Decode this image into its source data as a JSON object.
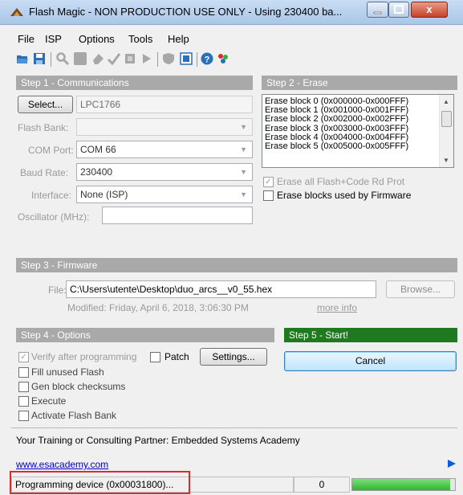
{
  "window": {
    "title": "Flash Magic - NON PRODUCTION USE ONLY - Using 230400 ba...",
    "close_glyph": "x"
  },
  "menu": [
    "File",
    "ISP",
    "Options",
    "Tools",
    "Help"
  ],
  "toolbar": {
    "icons": [
      "open-icon",
      "save-icon",
      "search-icon",
      "blank-check-icon",
      "erase-icon",
      "verify-icon",
      "read-icon",
      "go-icon",
      "security-icon",
      "terminal-icon",
      "help-icon",
      "people-icon"
    ]
  },
  "step1": {
    "header": "Step 1 - Communications",
    "select_label": "Select...",
    "device": "LPC1766",
    "flash_bank_label": "Flash Bank:",
    "flash_bank_value": "",
    "com_port_label": "COM Port:",
    "com_port_value": "COM 66",
    "baud_label": "Baud Rate:",
    "baud_value": "230400",
    "interface_label": "Interface:",
    "interface_value": "None (ISP)",
    "osc_label": "Oscillator (MHz):",
    "osc_value": ""
  },
  "step2": {
    "header": "Step 2 - Erase",
    "blocks": [
      "Erase block 0 (0x000000-0x000FFF)",
      "Erase block 1 (0x001000-0x001FFF)",
      "Erase block 2 (0x002000-0x002FFF)",
      "Erase block 3 (0x003000-0x003FFF)",
      "Erase block 4 (0x004000-0x004FFF)",
      "Erase block 5 (0x005000-0x005FFF)"
    ],
    "erase_all_label": "Erase all Flash+Code Rd Prot",
    "erase_used_label": "Erase blocks used by Firmware"
  },
  "step3": {
    "header": "Step 3 - Firmware",
    "file_label": "File:",
    "file_value": "C:\\Users\\utente\\Desktop\\duo_arcs__v0_55.hex",
    "browse_label": "Browse...",
    "modified": "Modified: Friday, April 6, 2018, 3:06:30 PM",
    "more_info": "more info"
  },
  "step4": {
    "header": "Step 4 - Options",
    "verify_label": "Verify after programming",
    "patch_label": "Patch",
    "settings_label": "Settings...",
    "options": [
      "Fill unused Flash",
      "Gen block checksums",
      "Execute",
      "Activate Flash Bank"
    ]
  },
  "step5": {
    "header": "Step 5 - Start!",
    "cancel_label": "Cancel"
  },
  "footer": {
    "partner": "Your Training or Consulting Partner: Embedded Systems Academy",
    "link": "www.esacademy.com"
  },
  "status": {
    "message": "Programming device (0x00031800)...",
    "count": "0",
    "progress_fraction": 0.95
  },
  "colors": {
    "section_header": "#a9a9a9",
    "start_header": "#1f7a1f",
    "progress": "#2fb42f",
    "highlight_box": "#e0282f"
  }
}
